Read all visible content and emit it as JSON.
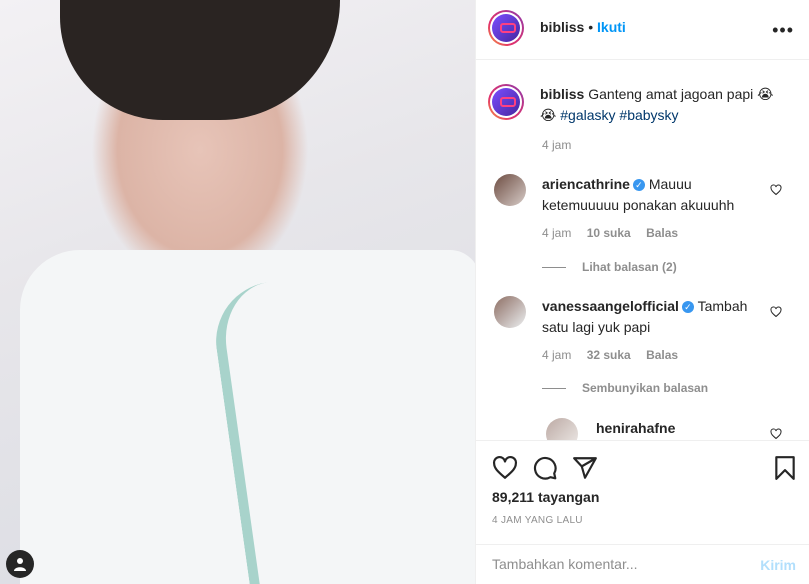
{
  "post": {
    "username": "bibliss",
    "follow_label": "Ikuti",
    "more_icon": "more-dots-icon",
    "caption_text": "Ganteng amat jagoan papi 😭",
    "caption_line2_emoji": "😭",
    "hashtags": [
      "#galasky",
      "#babysky"
    ],
    "caption_time": "4 jam"
  },
  "comments": [
    {
      "username": "ariencathrine",
      "verified": true,
      "text_line1": "Mauuu",
      "text_line2": "ketemuuuuu ponakan akuuuhh",
      "time": "4 jam",
      "likes": "10 suka",
      "reply_label": "Balas",
      "replies_toggle": "Lihat balasan (2)"
    },
    {
      "username": "vanessaangelofficial",
      "verified": true,
      "text_line1": "Tambah",
      "text_line2": "satu lagi yuk papi",
      "time": "4 jam",
      "likes": "32 suka",
      "reply_label": "Balas",
      "replies_toggle": "Sembunyikan balasan"
    },
    {
      "username": "henirahafne"
    }
  ],
  "actions": {
    "like_icon": "heart-icon",
    "comment_icon": "comment-icon",
    "share_icon": "share-icon",
    "save_icon": "bookmark-icon",
    "views": "89,211 tayangan",
    "timestamp": "4 JAM YANG LALU"
  },
  "add_comment": {
    "placeholder": "Tambahkan komentar...",
    "send_label": "Kirim"
  },
  "colors": {
    "link_blue": "#0095f6",
    "hashtag": "#00376b",
    "muted": "#8e8e8e",
    "verified": "#3897f0"
  }
}
